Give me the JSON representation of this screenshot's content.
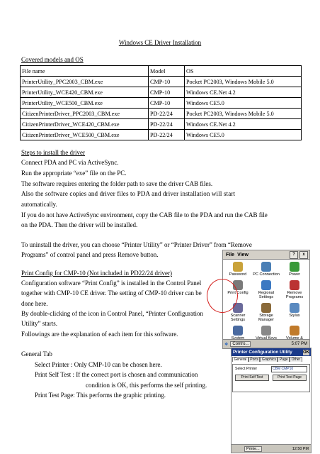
{
  "title": "Windows CE Driver Installation",
  "covered_heading": "Covered models and OS",
  "models_table": {
    "headers": [
      "File name",
      "Model",
      "OS"
    ],
    "rows": [
      [
        "PrinterUtility_PPC2003_CBM.exe",
        "CMP-10",
        "Pocket PC2003, Windows Mobile 5.0"
      ],
      [
        "PrinterUtility_WCE420_CBM.exe",
        "CMP-10",
        "Windows CE.Net 4.2"
      ],
      [
        "PrinterUtility_WCE500_CBM.exe",
        "CMP-10",
        "Windows CE5.0"
      ],
      [
        "CitizenPrinterDriver_PPC2003_CBM.exe",
        "PD-22/24",
        "Pocket PC2003, Windows Mobile 5.0"
      ],
      [
        "CitizenPrinterDriver_WCE420_CBM.exe",
        "PD-22/24",
        "Windows CE.Net 4.2"
      ],
      [
        "CitizenPrinterDriver_WCE500_CBM.exe",
        "PD-22/24",
        "Windows CE5.0"
      ]
    ]
  },
  "steps_heading": "Steps to install the driver",
  "steps": [
    "Connect PDA and PC via ActiveSync.",
    "Run the appropriate “exe” file on the PC.",
    "The software requires entering the folder path to save the driver CAB files.",
    "Also the software copies and driver files to PDA and driver installation will start",
    "automatically.",
    "If you do not have ActiveSync environment, copy the CAB file to the PDA and run the CAB file",
    "on the PDA. Then the driver will be installed."
  ],
  "uninstall": [
    "To uninstall the driver, you can choose “Printer Utility” or “Printer Driver” from “Remove",
    "Programs” of control panel and press Remove button."
  ],
  "config_heading": "Print Config for CMP-10 (Not included in PD22/24 driver)",
  "config_text": [
    "Configuration software “Print Config” is installed in the Control Panel",
    "together with CMP-10 CE driver. The setting of CMP-10 driver can be",
    "done here.",
    "By double-clicking of the icon in Control Panel, “Printer Configuration",
    "Utility” starts.",
    "Followings are the explanation of each item for this software."
  ],
  "general_tab": {
    "heading": "General Tab",
    "select_printer": "Select Printer :   Only CMP-10 can be chosen here.",
    "print_self_test_1": "Print Self Test : If the correct port is chosen and communication",
    "print_self_test_2": "condition is OK, this performs the self printing.",
    "print_test_page": "Print Test Page: This performs the graphic printing."
  },
  "control_panel_screenshot": {
    "menu": [
      "File",
      "View"
    ],
    "buttons": [
      "?",
      "x"
    ],
    "items": [
      {
        "label": "Password",
        "icon": "key-icon",
        "color": "#c9a23a"
      },
      {
        "label": "PC Connection",
        "icon": "pc-connection-icon",
        "color": "#4a7fb5"
      },
      {
        "label": "Power",
        "icon": "power-icon",
        "color": "#3a9a3a"
      },
      {
        "label": "Print Config",
        "icon": "printer-icon",
        "color": "#7a7a7a"
      },
      {
        "label": "Regional Settings",
        "icon": "globe-icon",
        "color": "#3d79c2"
      },
      {
        "label": "Remove Programs",
        "icon": "remove-programs-icon",
        "color": "#b33"
      },
      {
        "label": "Scanner Settings",
        "icon": "scanner-icon",
        "color": "#6a6a9a"
      },
      {
        "label": "Storage Manager",
        "icon": "storage-icon",
        "color": "#8a6a3a"
      },
      {
        "label": "Stylus",
        "icon": "stylus-icon",
        "color": "#5a8ac0"
      },
      {
        "label": "System",
        "icon": "system-icon",
        "color": "#4a6aa0"
      },
      {
        "label": "Virtual Keys",
        "icon": "keys-icon",
        "color": "#888"
      },
      {
        "label": "Volume & Sounds",
        "icon": "volume-icon",
        "color": "#c07a2a"
      }
    ],
    "taskbar": "Contro...",
    "clock": "5:07 PM"
  },
  "utility_screenshot": {
    "title": "Printer Configuration Utility",
    "ok": "OK",
    "tabs": [
      "General",
      "Ports",
      "Graphics",
      "Page",
      "Other"
    ],
    "select_label": "Select Printer",
    "select_value": "CBM CMP10",
    "self_test_button": "Print Self Test",
    "test_page_button": "Print Test Page",
    "taskbar": "Printe...",
    "clock": "12:50 PM"
  }
}
